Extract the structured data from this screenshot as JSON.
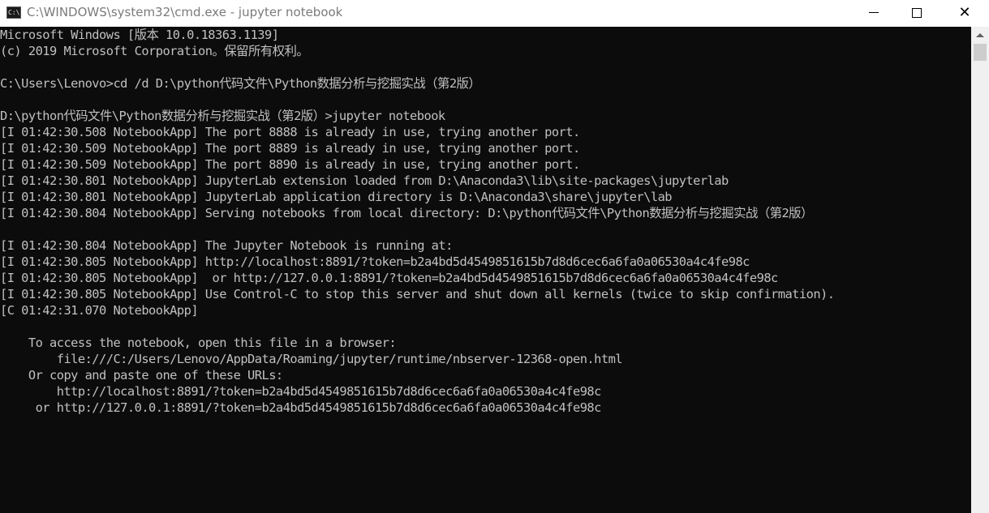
{
  "window": {
    "title": "C:\\WINDOWS\\system32\\cmd.exe - jupyter  notebook",
    "icon_text": "C:\\",
    "controls": {
      "minimize": "minimize-icon",
      "maximize": "maximize-icon",
      "close": "✕"
    }
  },
  "console": {
    "lines": [
      "Microsoft Windows [版本 10.0.18363.1139]",
      "(c) 2019 Microsoft Corporation。保留所有权利。",
      "",
      "C:\\Users\\Lenovo>cd /d D:\\python代码文件\\Python数据分析与挖掘实战（第2版）",
      "",
      "D:\\python代码文件\\Python数据分析与挖掘实战（第2版）>jupyter notebook",
      "[I 01:42:30.508 NotebookApp] The port 8888 is already in use, trying another port.",
      "[I 01:42:30.509 NotebookApp] The port 8889 is already in use, trying another port.",
      "[I 01:42:30.509 NotebookApp] The port 8890 is already in use, trying another port.",
      "[I 01:42:30.801 NotebookApp] JupyterLab extension loaded from D:\\Anaconda3\\lib\\site-packages\\jupyterlab",
      "[I 01:42:30.801 NotebookApp] JupyterLab application directory is D:\\Anaconda3\\share\\jupyter\\lab",
      "[I 01:42:30.804 NotebookApp] Serving notebooks from local directory: D:\\python代码文件\\Python数据分析与挖掘实战（第2版）",
      "",
      "[I 01:42:30.804 NotebookApp] The Jupyter Notebook is running at:",
      "[I 01:42:30.805 NotebookApp] http://localhost:8891/?token=b2a4bd5d4549851615b7d8d6cec6a6fa0a06530a4c4fe98c",
      "[I 01:42:30.805 NotebookApp]  or http://127.0.0.1:8891/?token=b2a4bd5d4549851615b7d8d6cec6a6fa0a06530a4c4fe98c",
      "[I 01:42:30.805 NotebookApp] Use Control-C to stop this server and shut down all kernels (twice to skip confirmation).",
      "[C 01:42:31.070 NotebookApp]",
      "",
      "    To access the notebook, open this file in a browser:",
      "        file:///C:/Users/Lenovo/AppData/Roaming/jupyter/runtime/nbserver-12368-open.html",
      "    Or copy and paste one of these URLs:",
      "        http://localhost:8891/?token=b2a4bd5d4549851615b7d8d6cec6a6fa0a06530a4c4fe98c",
      "     or http://127.0.0.1:8891/?token=b2a4bd5d4549851615b7d8d6cec6a6fa0a06530a4c4fe98c"
    ]
  },
  "colors": {
    "console_bg": "#0c0c0c",
    "console_text": "#c0c0c0",
    "titlebar_bg": "#ffffff",
    "title_text": "#7a7a7a"
  }
}
